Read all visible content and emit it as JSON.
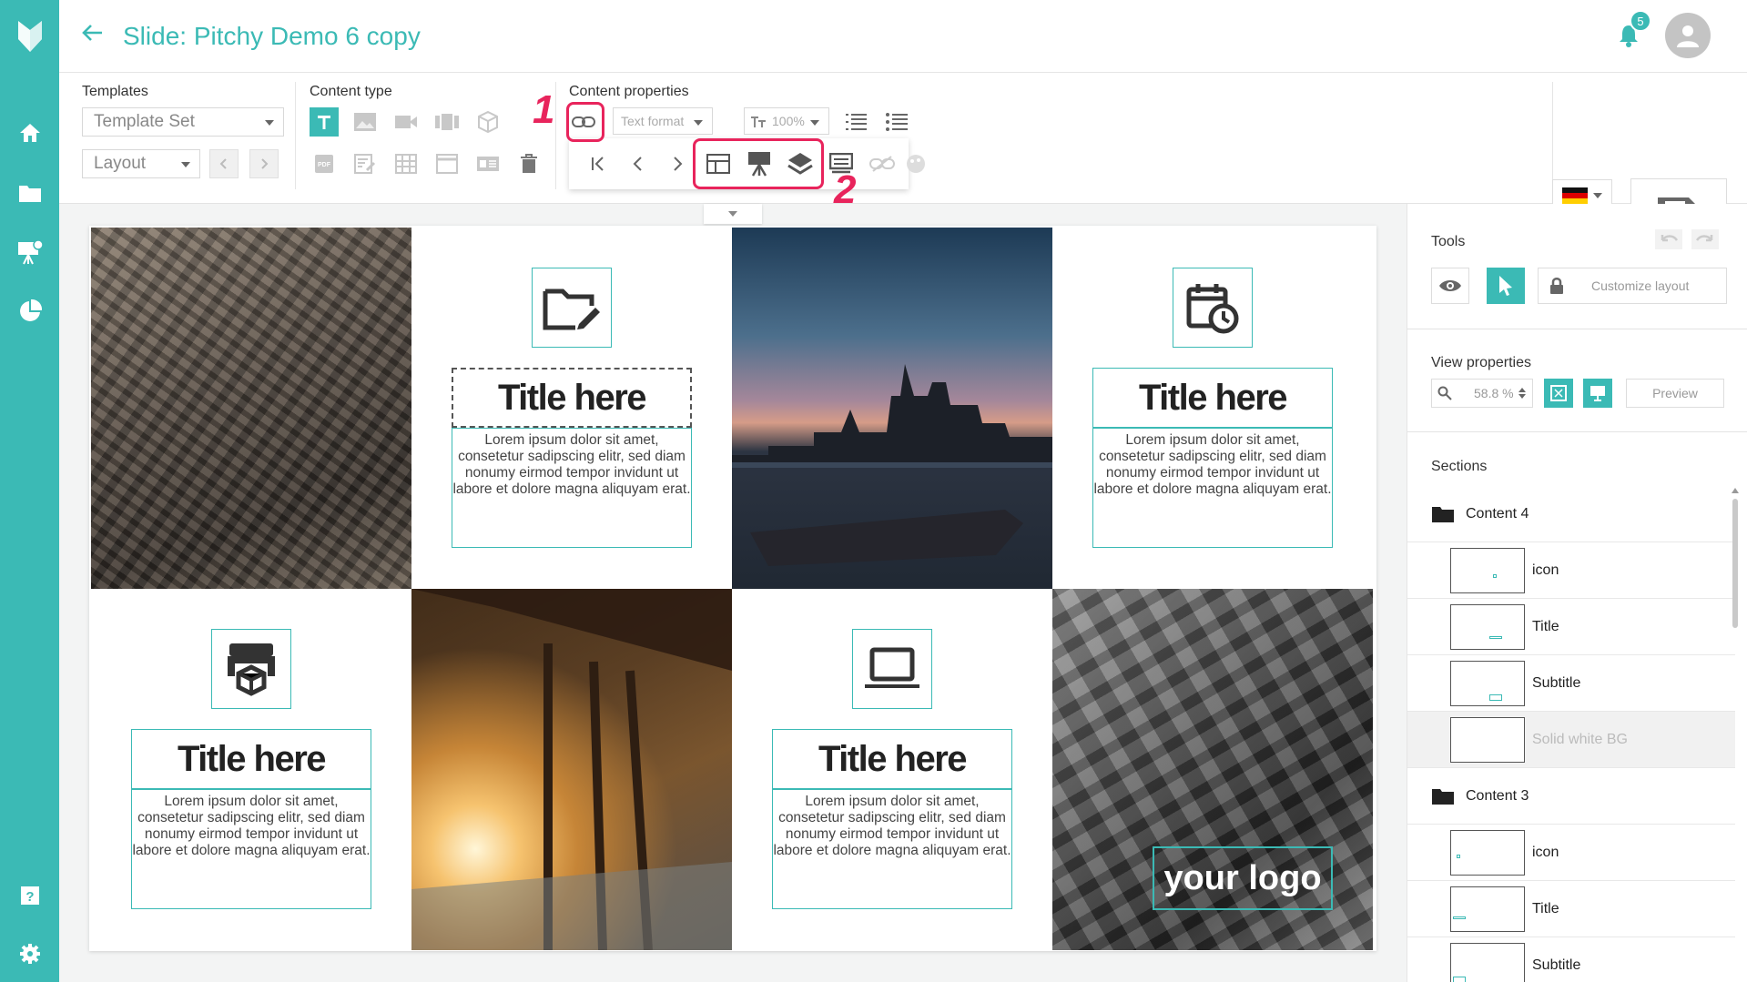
{
  "app": {
    "title": "Slide: Pitchy Demo 6 copy",
    "notification_count": "5"
  },
  "toolbar": {
    "templates_label": "Templates",
    "template_set": "Template Set",
    "layout": "Layout",
    "content_type_label": "Content type",
    "content_properties_label": "Content properties",
    "text_format": "Text format",
    "font_size": "100%"
  },
  "annotations": {
    "marker_1": "1",
    "marker_2": "2"
  },
  "slide": {
    "cards": [
      {
        "icon": "folder-edit-icon",
        "title": "Title here",
        "body": "Lorem ipsum dolor sit amet, consetetur sadipscing elitr, sed diam nonumy eirmod tempor invidunt ut labore et dolore magna aliquyam erat."
      },
      {
        "icon": "calendar-clock-icon",
        "title": "Title here",
        "body": "Lorem ipsum dolor sit amet, consetetur sadipscing elitr, sed diam nonumy eirmod tempor invidunt ut labore et dolore magna aliquyam erat."
      },
      {
        "icon": "printer-3d-icon",
        "title": "Title here",
        "body": "Lorem ipsum dolor sit amet, consetetur sadipscing elitr, sed diam nonumy eirmod tempor invidunt ut labore et dolore magna aliquyam erat."
      },
      {
        "icon": "laptop-icon",
        "title": "Title here",
        "body": "Lorem ipsum dolor sit amet, consetetur sadipscing elitr, sed diam nonumy eirmod tempor invidunt ut labore et dolore magna aliquyam erat."
      }
    ],
    "logo_text": "your logo"
  },
  "right_panel": {
    "tools_label": "Tools",
    "customize_layout": "Customize layout",
    "view_properties_label": "View properties",
    "zoom": "58.8 %",
    "preview": "Preview",
    "sections_label": "Sections",
    "sections": [
      {
        "name": "Content 4",
        "items": [
          "icon",
          "Title",
          "Subtitle",
          "Solid white BG"
        ]
      },
      {
        "name": "Content 3",
        "items": [
          "icon",
          "Title",
          "Subtitle"
        ]
      }
    ]
  },
  "colors": {
    "accent": "#3bbab5",
    "highlight": "#e8245c"
  }
}
